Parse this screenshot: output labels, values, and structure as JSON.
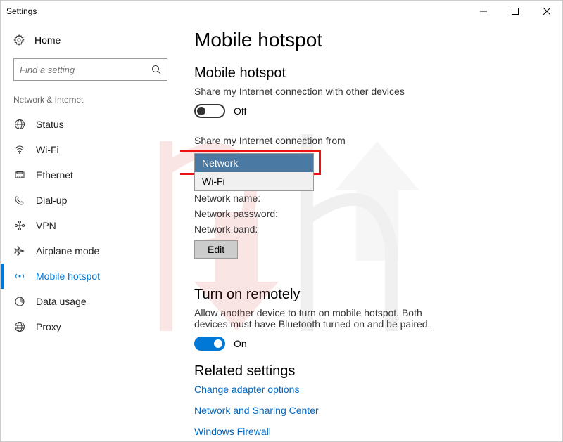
{
  "window": {
    "title": "Settings"
  },
  "sidebar": {
    "home": "Home",
    "search_placeholder": "Find a setting",
    "category": "Network & Internet",
    "items": [
      {
        "label": "Status"
      },
      {
        "label": "Wi-Fi"
      },
      {
        "label": "Ethernet"
      },
      {
        "label": "Dial-up"
      },
      {
        "label": "VPN"
      },
      {
        "label": "Airplane mode"
      },
      {
        "label": "Mobile hotspot"
      },
      {
        "label": "Data usage"
      },
      {
        "label": "Proxy"
      }
    ]
  },
  "main": {
    "page_title": "Mobile hotspot",
    "hotspot": {
      "heading": "Mobile hotspot",
      "desc": "Share my Internet connection with other devices",
      "toggle_state": "Off"
    },
    "share_from": {
      "label": "Share my Internet connection from",
      "options": [
        "Network",
        "Wi-Fi"
      ],
      "selected": "Network"
    },
    "fields": {
      "name_label": "Network name:",
      "password_label": "Network password:",
      "band_label": "Network band:",
      "edit_button": "Edit"
    },
    "remote": {
      "heading": "Turn on remotely",
      "desc": "Allow another device to turn on mobile hotspot. Both devices must have Bluetooth turned on and be paired.",
      "toggle_state": "On"
    },
    "related": {
      "heading": "Related settings",
      "links": [
        "Change adapter options",
        "Network and Sharing Center",
        "Windows Firewall"
      ]
    }
  }
}
